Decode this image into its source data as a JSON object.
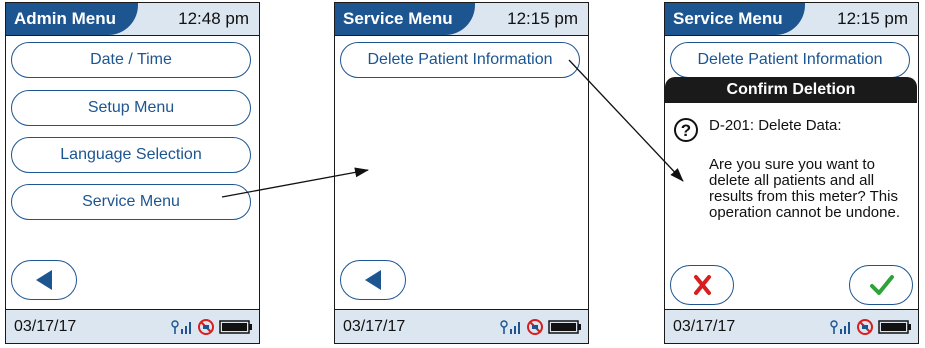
{
  "screen1": {
    "title": "Admin Menu",
    "time": "12:48 pm",
    "menu": [
      "Date / Time",
      "Setup Menu",
      "Language Selection",
      "Service Menu"
    ],
    "date": "03/17/17"
  },
  "screen2": {
    "title": "Service Menu",
    "time": "12:15 pm",
    "menu": [
      "Delete Patient Information"
    ],
    "date": "03/17/17"
  },
  "screen3": {
    "title": "Service Menu",
    "time": "12:15 pm",
    "menu": [
      "Delete Patient Information"
    ],
    "dialog": {
      "title": "Confirm Deletion",
      "code": "D-201: Delete Data:",
      "message": "Are you sure you want to delete all patients and all results from this meter? This operation cannot be undone."
    },
    "date": "03/17/17"
  },
  "icons": {
    "back": "back-arrow-icon",
    "signal": "wireless-signal-icon",
    "no-connection": "no-connection-icon",
    "battery": "battery-icon",
    "question": "question-icon",
    "cancel": "x-icon",
    "confirm": "check-icon"
  },
  "colors": {
    "accent": "#1d5591",
    "bar": "#dce6f0",
    "cancel": "#d81e1e",
    "confirm": "#2fa33a"
  }
}
